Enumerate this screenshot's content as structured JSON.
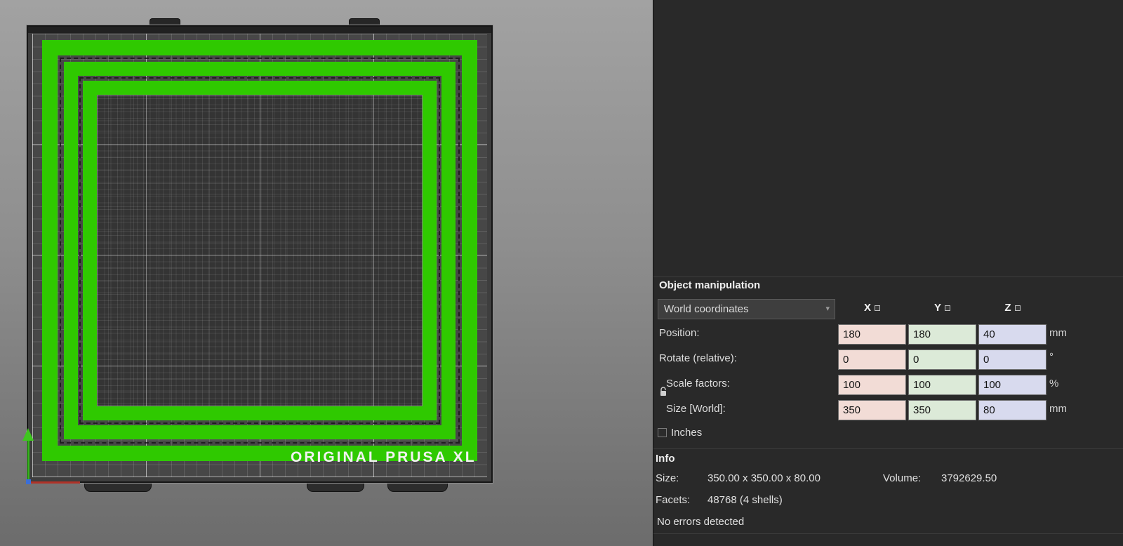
{
  "viewport": {
    "bed_label": "ORIGINAL PRUSA XL"
  },
  "object_manipulation": {
    "title": "Object manipulation",
    "coordinates_dropdown": "World coordinates",
    "axis_headers": [
      "X",
      "Y",
      "Z"
    ],
    "rows": [
      {
        "label": "Position:",
        "values": [
          "180",
          "180",
          "40"
        ],
        "unit": "mm"
      },
      {
        "label": "Rotate (relative):",
        "values": [
          "0",
          "0",
          "0"
        ],
        "unit": "°"
      },
      {
        "label": "Scale factors:",
        "values": [
          "100",
          "100",
          "100"
        ],
        "unit": "%"
      },
      {
        "label": "Size [World]:",
        "values": [
          "350",
          "350",
          "80"
        ],
        "unit": "mm"
      }
    ],
    "inches_label": "Inches"
  },
  "info": {
    "title": "Info",
    "size_label": "Size:",
    "size_value": "350.00 x 350.00 x 80.00",
    "volume_label": "Volume:",
    "volume_value": "3792629.50",
    "facets_label": "Facets:",
    "facets_value": "48768 (4 shells)",
    "status": "No errors detected"
  },
  "colors": {
    "x_field": "#f2dcd6",
    "y_field": "#dcead8",
    "z_field": "#d8daee",
    "object_green": "#2fc900",
    "panel_bg": "#292929"
  }
}
